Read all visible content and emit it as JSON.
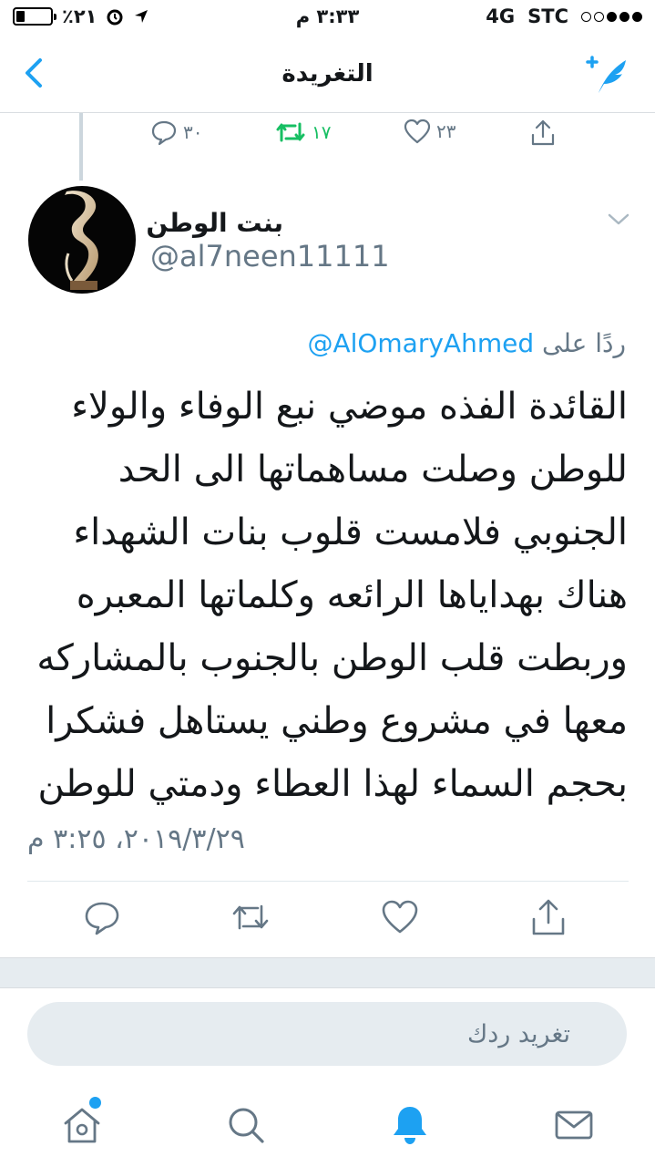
{
  "status_bar": {
    "battery_percent": "٪٢١",
    "time": "٣:٣٣ م",
    "network": "4G",
    "carrier": "STC",
    "signal_bars": 3
  },
  "nav": {
    "title": "التغريدة",
    "back_icon": "chevron-left-icon",
    "compose_icon": "compose-tweet-icon"
  },
  "previous_tweet_actions": {
    "replies": "٣٠",
    "retweets": "١٧",
    "likes": "٢٣",
    "retweeted": true
  },
  "tweet": {
    "author_name": "بنت الوطن",
    "author_handle": "@al7neen11111",
    "reply_prefix": "ردًا على",
    "reply_mention": "@AlOmaryAhmed",
    "text": "القائدة الفذه موضي نبع الوفاء والولاء\nللوطن وصلت مساهماتها الى  الحد\nالجنوبي فلامست قلوب بنات الشهداء\nهناك بهداياها الرائعه وكلماتها المعبره\nوربطت قلب الوطن بالجنوب بالمشاركه\nمعها في مشروع وطني يستاهل فشكرا\nبحجم السماء لهذا العطاء ودمتي للوطن",
    "timestamp": "٢٠١٩/٣/٢٩، ٣:٢٥ م"
  },
  "reply_box": {
    "placeholder": "تغريد ردك"
  },
  "tab_bar": {
    "items": [
      "home-icon",
      "search-icon",
      "notifications-icon",
      "messages-icon"
    ],
    "active": "notifications-icon",
    "accent": "#1da1f2"
  },
  "colors": {
    "accent": "#1da1f2",
    "retweet_green": "#17bf63",
    "secondary_text": "#657786"
  }
}
